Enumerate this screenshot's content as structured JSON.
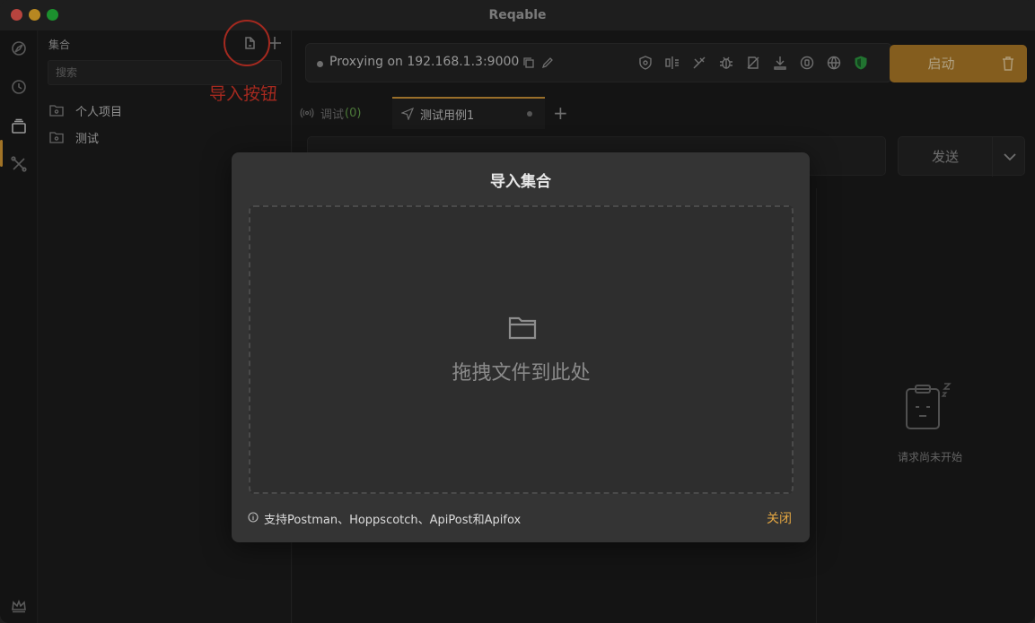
{
  "app": {
    "title": "Reqable"
  },
  "sidebar": {
    "title": "集合",
    "search_placeholder": "搜索",
    "items": [
      {
        "label": "个人项目"
      },
      {
        "label": "测试"
      }
    ]
  },
  "annotation": {
    "text": "导入按钮"
  },
  "proxy": {
    "status": "Proxying on 192.168.1.3:9000"
  },
  "start_button": {
    "label": "启动"
  },
  "tabs": {
    "debug_label": "调试",
    "debug_count": "(0)",
    "active_label": "测试用例1"
  },
  "request": {
    "send_label": "发送"
  },
  "response": {
    "empty_text": "请求尚未开始"
  },
  "modal": {
    "title": "导入集合",
    "drop_text": "拖拽文件到此处",
    "support_text": "支持Postman、Hoppscotch、ApiPost和Apifox",
    "close_label": "关闭"
  },
  "colors": {
    "accent": "#e5a742",
    "start_button": "#b8822a",
    "annotation": "#e53a2c",
    "shield_green": "#2ea043"
  }
}
